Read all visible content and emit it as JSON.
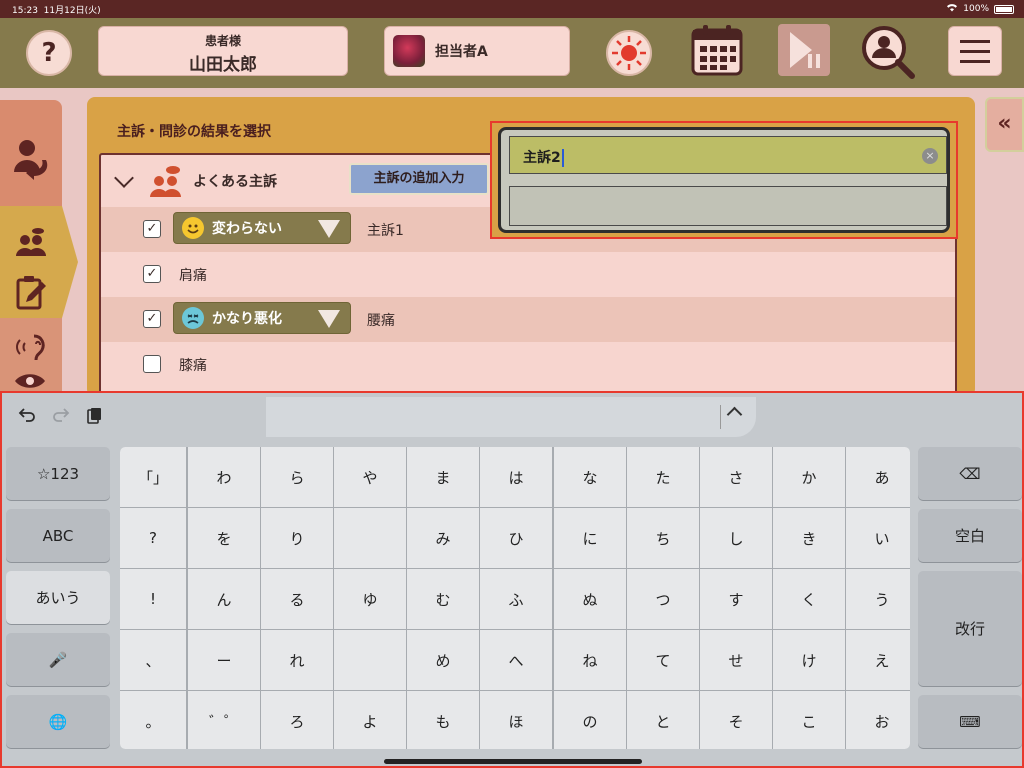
{
  "status": {
    "time": "15:23",
    "date": "11月12日(火)",
    "battery": "100%"
  },
  "header": {
    "help": "?",
    "patient_label": "患者様",
    "patient_name": "山田太郎",
    "staff_name": "担当者A"
  },
  "panel": {
    "title": "主訴・問診の結果を選択",
    "group_title": "よくある主訴",
    "add_button": "主訴の追加入力",
    "collapse": "«",
    "rows": [
      {
        "checked": "✓",
        "severity": "変わらない",
        "text": "主訴1"
      },
      {
        "checked": "✓",
        "text": "肩痛"
      },
      {
        "checked": "✓",
        "severity": "かなり悪化",
        "text": "腰痛"
      },
      {
        "checked": "",
        "text": "膝痛"
      }
    ]
  },
  "popover": {
    "field1_value": "主訴2",
    "field2_value": "",
    "clear": "×"
  },
  "keyboard": {
    "left_keys": [
      "☆123",
      "ABC",
      "あいう",
      "🎤",
      "🌐"
    ],
    "right_keys": [
      "⌫",
      "空白",
      "改行",
      "⌨"
    ],
    "columns": [
      [
        "「」",
        "?",
        "!",
        "、",
        "。"
      ],
      [
        "わ",
        "を",
        "ん",
        "ー",
        "゛゜"
      ],
      [
        "ら",
        "り",
        "る",
        "れ",
        "ろ"
      ],
      [
        "や",
        "",
        "ゆ",
        "",
        "よ"
      ],
      [
        "ま",
        "み",
        "む",
        "め",
        "も"
      ],
      [
        "は",
        "ひ",
        "ふ",
        "へ",
        "ほ"
      ],
      [
        "な",
        "に",
        "ぬ",
        "ね",
        "の"
      ],
      [
        "た",
        "ち",
        "つ",
        "て",
        "と"
      ],
      [
        "さ",
        "し",
        "す",
        "せ",
        "そ"
      ],
      [
        "か",
        "き",
        "く",
        "け",
        "こ"
      ],
      [
        "あ",
        "い",
        "う",
        "え",
        "お"
      ]
    ]
  }
}
